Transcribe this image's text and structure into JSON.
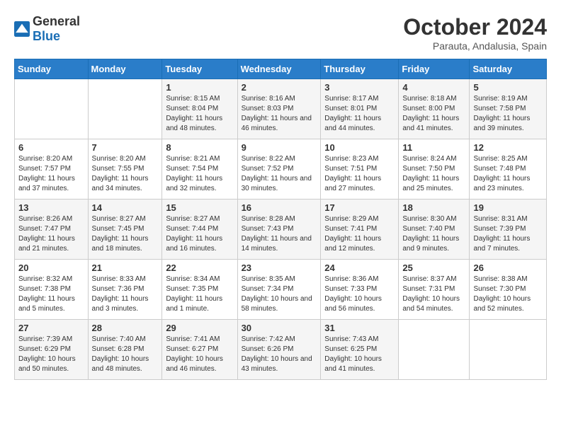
{
  "logo": {
    "general": "General",
    "blue": "Blue"
  },
  "title": "October 2024",
  "subtitle": "Parauta, Andalusia, Spain",
  "header_days": [
    "Sunday",
    "Monday",
    "Tuesday",
    "Wednesday",
    "Thursday",
    "Friday",
    "Saturday"
  ],
  "weeks": [
    [
      {
        "day": "",
        "sunrise": "",
        "sunset": "",
        "daylight": ""
      },
      {
        "day": "",
        "sunrise": "",
        "sunset": "",
        "daylight": ""
      },
      {
        "day": "1",
        "sunrise": "Sunrise: 8:15 AM",
        "sunset": "Sunset: 8:04 PM",
        "daylight": "Daylight: 11 hours and 48 minutes."
      },
      {
        "day": "2",
        "sunrise": "Sunrise: 8:16 AM",
        "sunset": "Sunset: 8:03 PM",
        "daylight": "Daylight: 11 hours and 46 minutes."
      },
      {
        "day": "3",
        "sunrise": "Sunrise: 8:17 AM",
        "sunset": "Sunset: 8:01 PM",
        "daylight": "Daylight: 11 hours and 44 minutes."
      },
      {
        "day": "4",
        "sunrise": "Sunrise: 8:18 AM",
        "sunset": "Sunset: 8:00 PM",
        "daylight": "Daylight: 11 hours and 41 minutes."
      },
      {
        "day": "5",
        "sunrise": "Sunrise: 8:19 AM",
        "sunset": "Sunset: 7:58 PM",
        "daylight": "Daylight: 11 hours and 39 minutes."
      }
    ],
    [
      {
        "day": "6",
        "sunrise": "Sunrise: 8:20 AM",
        "sunset": "Sunset: 7:57 PM",
        "daylight": "Daylight: 11 hours and 37 minutes."
      },
      {
        "day": "7",
        "sunrise": "Sunrise: 8:20 AM",
        "sunset": "Sunset: 7:55 PM",
        "daylight": "Daylight: 11 hours and 34 minutes."
      },
      {
        "day": "8",
        "sunrise": "Sunrise: 8:21 AM",
        "sunset": "Sunset: 7:54 PM",
        "daylight": "Daylight: 11 hours and 32 minutes."
      },
      {
        "day": "9",
        "sunrise": "Sunrise: 8:22 AM",
        "sunset": "Sunset: 7:52 PM",
        "daylight": "Daylight: 11 hours and 30 minutes."
      },
      {
        "day": "10",
        "sunrise": "Sunrise: 8:23 AM",
        "sunset": "Sunset: 7:51 PM",
        "daylight": "Daylight: 11 hours and 27 minutes."
      },
      {
        "day": "11",
        "sunrise": "Sunrise: 8:24 AM",
        "sunset": "Sunset: 7:50 PM",
        "daylight": "Daylight: 11 hours and 25 minutes."
      },
      {
        "day": "12",
        "sunrise": "Sunrise: 8:25 AM",
        "sunset": "Sunset: 7:48 PM",
        "daylight": "Daylight: 11 hours and 23 minutes."
      }
    ],
    [
      {
        "day": "13",
        "sunrise": "Sunrise: 8:26 AM",
        "sunset": "Sunset: 7:47 PM",
        "daylight": "Daylight: 11 hours and 21 minutes."
      },
      {
        "day": "14",
        "sunrise": "Sunrise: 8:27 AM",
        "sunset": "Sunset: 7:45 PM",
        "daylight": "Daylight: 11 hours and 18 minutes."
      },
      {
        "day": "15",
        "sunrise": "Sunrise: 8:27 AM",
        "sunset": "Sunset: 7:44 PM",
        "daylight": "Daylight: 11 hours and 16 minutes."
      },
      {
        "day": "16",
        "sunrise": "Sunrise: 8:28 AM",
        "sunset": "Sunset: 7:43 PM",
        "daylight": "Daylight: 11 hours and 14 minutes."
      },
      {
        "day": "17",
        "sunrise": "Sunrise: 8:29 AM",
        "sunset": "Sunset: 7:41 PM",
        "daylight": "Daylight: 11 hours and 12 minutes."
      },
      {
        "day": "18",
        "sunrise": "Sunrise: 8:30 AM",
        "sunset": "Sunset: 7:40 PM",
        "daylight": "Daylight: 11 hours and 9 minutes."
      },
      {
        "day": "19",
        "sunrise": "Sunrise: 8:31 AM",
        "sunset": "Sunset: 7:39 PM",
        "daylight": "Daylight: 11 hours and 7 minutes."
      }
    ],
    [
      {
        "day": "20",
        "sunrise": "Sunrise: 8:32 AM",
        "sunset": "Sunset: 7:38 PM",
        "daylight": "Daylight: 11 hours and 5 minutes."
      },
      {
        "day": "21",
        "sunrise": "Sunrise: 8:33 AM",
        "sunset": "Sunset: 7:36 PM",
        "daylight": "Daylight: 11 hours and 3 minutes."
      },
      {
        "day": "22",
        "sunrise": "Sunrise: 8:34 AM",
        "sunset": "Sunset: 7:35 PM",
        "daylight": "Daylight: 11 hours and 1 minute."
      },
      {
        "day": "23",
        "sunrise": "Sunrise: 8:35 AM",
        "sunset": "Sunset: 7:34 PM",
        "daylight": "Daylight: 10 hours and 58 minutes."
      },
      {
        "day": "24",
        "sunrise": "Sunrise: 8:36 AM",
        "sunset": "Sunset: 7:33 PM",
        "daylight": "Daylight: 10 hours and 56 minutes."
      },
      {
        "day": "25",
        "sunrise": "Sunrise: 8:37 AM",
        "sunset": "Sunset: 7:31 PM",
        "daylight": "Daylight: 10 hours and 54 minutes."
      },
      {
        "day": "26",
        "sunrise": "Sunrise: 8:38 AM",
        "sunset": "Sunset: 7:30 PM",
        "daylight": "Daylight: 10 hours and 52 minutes."
      }
    ],
    [
      {
        "day": "27",
        "sunrise": "Sunrise: 7:39 AM",
        "sunset": "Sunset: 6:29 PM",
        "daylight": "Daylight: 10 hours and 50 minutes."
      },
      {
        "day": "28",
        "sunrise": "Sunrise: 7:40 AM",
        "sunset": "Sunset: 6:28 PM",
        "daylight": "Daylight: 10 hours and 48 minutes."
      },
      {
        "day": "29",
        "sunrise": "Sunrise: 7:41 AM",
        "sunset": "Sunset: 6:27 PM",
        "daylight": "Daylight: 10 hours and 46 minutes."
      },
      {
        "day": "30",
        "sunrise": "Sunrise: 7:42 AM",
        "sunset": "Sunset: 6:26 PM",
        "daylight": "Daylight: 10 hours and 43 minutes."
      },
      {
        "day": "31",
        "sunrise": "Sunrise: 7:43 AM",
        "sunset": "Sunset: 6:25 PM",
        "daylight": "Daylight: 10 hours and 41 minutes."
      },
      {
        "day": "",
        "sunrise": "",
        "sunset": "",
        "daylight": ""
      },
      {
        "day": "",
        "sunrise": "",
        "sunset": "",
        "daylight": ""
      }
    ]
  ]
}
